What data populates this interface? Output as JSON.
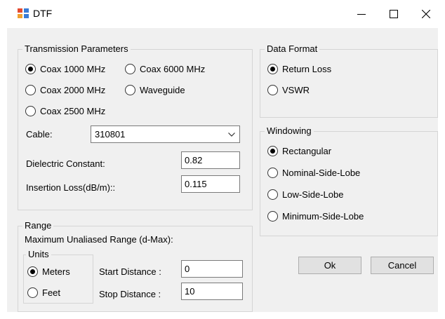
{
  "window": {
    "title": "DTF",
    "app_icon": "window-app-icon",
    "controls": {
      "minimize": "minimize-icon",
      "maximize": "maximize-icon",
      "close": "close-icon"
    }
  },
  "transmission": {
    "legend": "Transmission Parameters",
    "options": [
      "Coax 1000 MHz",
      "Coax 6000 MHz",
      "Coax 2000 MHz",
      "Waveguide",
      "Coax 2500 MHz"
    ],
    "selected": "Coax 1000 MHz",
    "cable_label": "Cable:",
    "cable_value": "310801",
    "dielectric_label": "Dielectric Constant:",
    "dielectric_value": "0.82",
    "insertion_label": "Insertion Loss(dB/m)::",
    "insertion_value": "0.115"
  },
  "range": {
    "legend": "Range",
    "max_label": "Maximum Unaliased Range (d-Max):",
    "units_legend": "Units",
    "unit_options": [
      "Meters",
      "Feet"
    ],
    "selected_unit": "Meters",
    "start_label": "Start Distance :",
    "start_value": "0",
    "stop_label": "Stop Distance :",
    "stop_value": "10"
  },
  "data_format": {
    "legend": "Data Format",
    "options": [
      "Return Loss",
      "VSWR"
    ],
    "selected": "Return Loss"
  },
  "windowing": {
    "legend": "Windowing",
    "options": [
      "Rectangular",
      "Nominal-Side-Lobe",
      "Low-Side-Lobe",
      "Minimum-Side-Lobe"
    ],
    "selected": "Rectangular"
  },
  "buttons": {
    "ok": "Ok",
    "cancel": "Cancel"
  },
  "colors": {
    "client_bg": "#f0f0f0",
    "group_border": "#d5d5d5",
    "button_bg": "#e1e1e1"
  }
}
